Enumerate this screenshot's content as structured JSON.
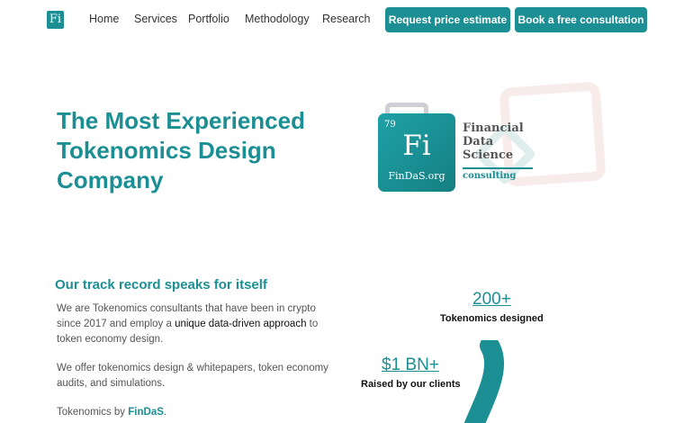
{
  "header": {
    "logo_text": "Fi",
    "nav": [
      {
        "label": "Home"
      },
      {
        "label": "Services"
      },
      {
        "label": "Portfolio"
      },
      {
        "label": "Methodology"
      },
      {
        "label": "Research"
      }
    ],
    "cta_estimate": "Request price estimate",
    "cta_consult": "Book a free consultation"
  },
  "hero": {
    "title_lines": [
      "The Most Experienced",
      "Tokenomics Design",
      "Company"
    ],
    "logo": {
      "number": "79",
      "symbol": "Fi",
      "site": "FinDaS.org",
      "words": [
        "Financial",
        "Data",
        "Science"
      ],
      "tagline": "consulting"
    }
  },
  "track_record": {
    "title": "Our track record speaks for itself",
    "para1_before": "We are Tokenomics consultants that have been in crypto since 2017 and employ a ",
    "para1_highlight": "unique data-driven approach",
    "para1_after": " to token economy design.",
    "para2": "We offer tokenomics design & whitepapers, token economy audits, and simulations.",
    "para3_prefix": "Tokenomics by ",
    "para3_brand": "FinDaS",
    "para3_suffix": ".",
    "stats": [
      {
        "value": "200+",
        "label": "Tokenomics designed"
      },
      {
        "value": "$1 BN+",
        "label": "Raised by our clients"
      }
    ]
  },
  "colors": {
    "accent": "#1b8f93",
    "deco_pink": "#f7ecea",
    "deco_gray": "#cfcfd6"
  }
}
